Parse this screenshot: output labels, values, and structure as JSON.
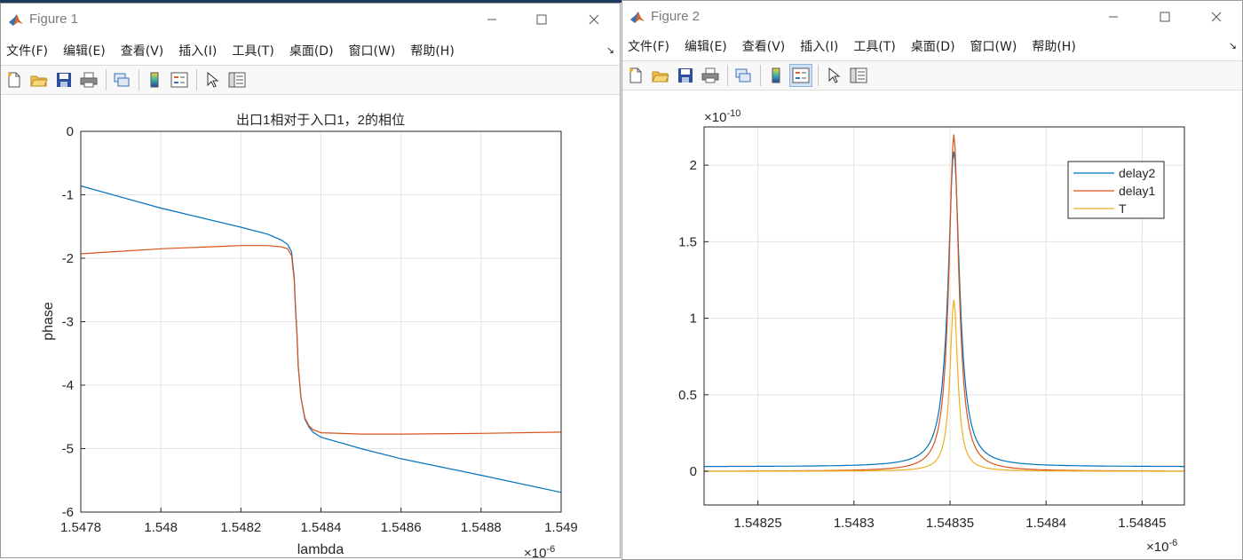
{
  "figure1": {
    "window_title": "Figure 1",
    "menu": [
      "文件(F)",
      "编辑(E)",
      "查看(V)",
      "插入(I)",
      "工具(T)",
      "桌面(D)",
      "窗口(W)",
      "帮助(H)"
    ],
    "toolbar_icons": [
      "new-figure-icon",
      "open-file-icon",
      "save-icon",
      "print-icon",
      "link-icon",
      "colorbar-icon",
      "legend-icon",
      "pointer-icon",
      "property-inspector-icon"
    ],
    "chart_data": {
      "type": "line",
      "title": "出口1相对于入口1，2的相位",
      "xlabel": "lambda",
      "ylabel": "phase",
      "x_exponent_label": "×10",
      "x_exponent_power": "-6",
      "xlim": [
        1.5478,
        1.549
      ],
      "ylim": [
        -6,
        0
      ],
      "xticks": [
        "1.5478",
        "1.548",
        "1.5482",
        "1.5484",
        "1.5486",
        "1.5488",
        "1.549"
      ],
      "yticks": [
        "0",
        "-1",
        "-2",
        "-3",
        "-4",
        "-5",
        "-6"
      ],
      "grid": true,
      "x": [
        1.5478,
        1.548,
        1.5482,
        1.5482666,
        1.5483,
        1.5483166,
        1.5483266,
        1.5483333,
        1.5483366,
        1.54834,
        1.5483433,
        1.54835,
        1.54836,
        1.54837,
        1.54838,
        1.5484,
        1.5485,
        1.5486,
        1.5488,
        1.549
      ],
      "series": [
        {
          "color": "#0072BD",
          "values": [
            -0.86,
            -1.21,
            -1.51,
            -1.62,
            -1.71,
            -1.78,
            -1.9,
            -2.3,
            -2.8,
            -3.2,
            -3.7,
            -4.2,
            -4.54,
            -4.66,
            -4.74,
            -4.82,
            -5.0,
            -5.16,
            -5.42,
            -5.69
          ]
        },
        {
          "color": "#D95319",
          "values": [
            -1.93,
            -1.85,
            -1.8,
            -1.8,
            -1.82,
            -1.85,
            -1.96,
            -2.35,
            -2.85,
            -3.2,
            -3.7,
            -4.2,
            -4.52,
            -4.64,
            -4.7,
            -4.75,
            -4.77,
            -4.77,
            -4.76,
            -4.74
          ]
        }
      ]
    }
  },
  "figure2": {
    "window_title": "Figure 2",
    "menu": [
      "文件(F)",
      "编辑(E)",
      "查看(V)",
      "插入(I)",
      "工具(T)",
      "桌面(D)",
      "窗口(W)",
      "帮助(H)"
    ],
    "toolbar_icons": [
      "new-figure-icon",
      "open-file-icon",
      "save-icon",
      "print-icon",
      "link-icon",
      "colorbar-icon",
      "legend-icon",
      "pointer-icon",
      "property-inspector-icon"
    ],
    "chart_data": {
      "type": "line",
      "title": "",
      "xlabel": "",
      "ylabel": "",
      "x_exponent_label": "×10",
      "x_exponent_power": "-6",
      "y_exponent_label": "×10",
      "y_exponent_power": "-10",
      "xlim": [
        1.548222,
        1.548472
      ],
      "ylim": [
        -0.22,
        2.25
      ],
      "xticks_values": [
        1.54825,
        1.5483,
        1.54835,
        1.5484,
        1.54845
      ],
      "xticks": [
        "1.54825",
        "1.5483",
        "1.54835",
        "1.5484",
        "1.54845"
      ],
      "yticks_values": [
        0,
        0.5,
        1,
        1.5,
        2
      ],
      "yticks": [
        "0",
        "0.5",
        "1",
        "1.5",
        "2"
      ],
      "grid": true,
      "legend_position": "top-right",
      "center": 1.548352,
      "series": [
        {
          "name": "delay2",
          "color": "#0072BD",
          "peak": 2.09,
          "gamma": 3.6e-06,
          "offset": 0.03
        },
        {
          "name": "delay1",
          "color": "#D95319",
          "peak": 2.2,
          "gamma": 3.1e-06,
          "offset": 0.0
        },
        {
          "name": "T",
          "color": "#EDB120",
          "peak": 1.12,
          "gamma": 2.4e-06,
          "offset": 0.0
        }
      ]
    }
  }
}
